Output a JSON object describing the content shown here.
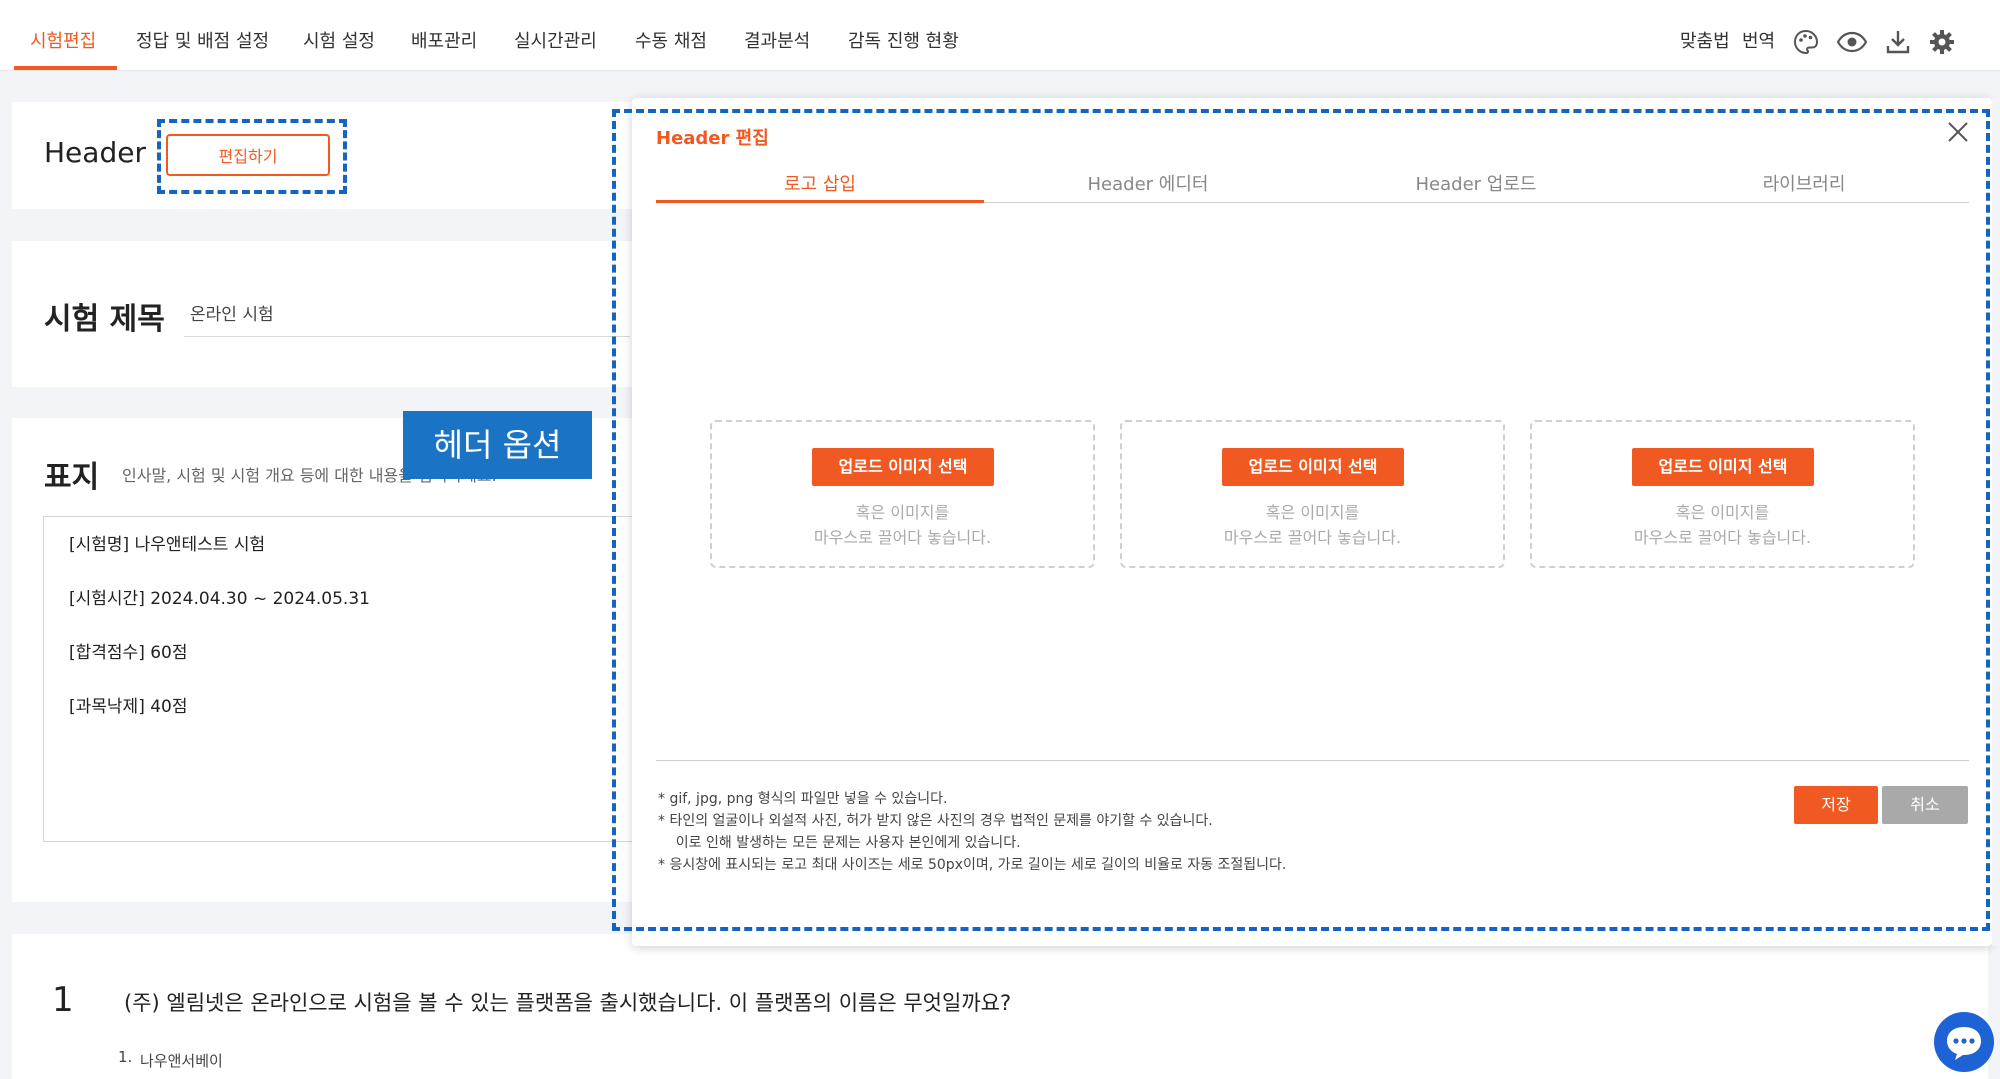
{
  "nav": {
    "tabs": [
      "시험편집",
      "정답 및 배점 설정",
      "시험 설정",
      "배포관리",
      "실시간관리",
      "수동 채점",
      "결과분석",
      "감독 진행 현황"
    ],
    "spell_check": "맞춤법",
    "translate": "번역",
    "icons": [
      "palette-icon",
      "eye-icon",
      "download-icon",
      "gear-icon"
    ]
  },
  "header_card": {
    "label": "Header",
    "edit_button": "편집하기"
  },
  "title_card": {
    "label": "시험 제목",
    "value": "온라인 시험"
  },
  "cover_card": {
    "label": "표지",
    "description": "인사말, 시험 및 시험 개요 등에 대한 내용을 입력하세요.",
    "lines": [
      "[시험명] 나우앤테스트 시험",
      "[시험시간] 2024.04.30 ~ 2024.05.31",
      "[합격점수] 60점",
      "[과목낙제] 40점"
    ]
  },
  "callout": "헤더 옵션",
  "question": {
    "number": "1",
    "text": "(주) 엘림넷은 온라인으로 시험을 볼 수 있는 플랫폼을 출시했습니다. 이 플랫폼의 이름은 무엇일까요?",
    "option_number": "1.",
    "option": "나우앤서베이"
  },
  "modal": {
    "title": "Header 편집",
    "tabs": [
      "로고 삽입",
      "Header 에디터",
      "Header 업로드",
      "라이브러리"
    ],
    "upload_button": "업로드 이미지 선택",
    "upload_hint_1": "혹은 이미지를",
    "upload_hint_2": "마우스로 끌어다 놓습니다.",
    "notes": [
      "*  gif, jpg, png 형식의 파일만 넣을 수 있습니다.",
      "*  타인의 얼굴이나 외설적 사진, 허가 받지 않은 사진의 경우 법적인 문제를 야기할 수 있습니다.",
      "    이로 인해 발생하는 모든 문제는 사용자 본인에게 있습니다.",
      "*  응시창에 표시되는 로고 최대 사이즈는 세로 50px이며, 가로 길이는 세로 길이의 비율로 자동 조절됩니다."
    ],
    "save": "저장",
    "cancel": "취소"
  },
  "colors": {
    "accent": "#f05a22",
    "annotation": "#1565c0",
    "chat": "#1e63d6"
  }
}
